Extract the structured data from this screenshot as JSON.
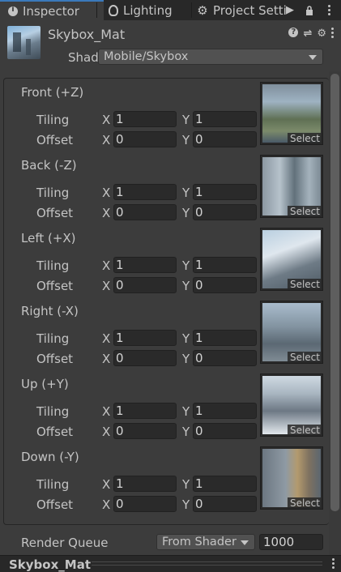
{
  "tabs": [
    {
      "label": "Inspector",
      "icon": "info-icon"
    },
    {
      "label": "Lighting",
      "icon": "bulb-icon"
    },
    {
      "label": "Project Setti",
      "icon": "gear-icon"
    }
  ],
  "material": {
    "name": "Skybox_Mat"
  },
  "shader": {
    "label": "Shader",
    "value": "Mobile/Skybox"
  },
  "faces": [
    {
      "title": "Front (+Z)",
      "tiling_label": "Tiling",
      "offset_label": "Offset",
      "tiling": {
        "x": "1",
        "y": "1"
      },
      "offset": {
        "x": "0",
        "y": "0"
      },
      "select": "Select"
    },
    {
      "title": "Back (-Z)",
      "tiling_label": "Tiling",
      "offset_label": "Offset",
      "tiling": {
        "x": "1",
        "y": "1"
      },
      "offset": {
        "x": "0",
        "y": "0"
      },
      "select": "Select"
    },
    {
      "title": "Left (+X)",
      "tiling_label": "Tiling",
      "offset_label": "Offset",
      "tiling": {
        "x": "1",
        "y": "1"
      },
      "offset": {
        "x": "0",
        "y": "0"
      },
      "select": "Select"
    },
    {
      "title": "Right (-X)",
      "tiling_label": "Tiling",
      "offset_label": "Offset",
      "tiling": {
        "x": "1",
        "y": "1"
      },
      "offset": {
        "x": "0",
        "y": "0"
      },
      "select": "Select"
    },
    {
      "title": "Up (+Y)",
      "tiling_label": "Tiling",
      "offset_label": "Offset",
      "tiling": {
        "x": "1",
        "y": "1"
      },
      "offset": {
        "x": "0",
        "y": "0"
      },
      "select": "Select"
    },
    {
      "title": "Down (-Y)",
      "tiling_label": "Tiling",
      "offset_label": "Offset",
      "tiling": {
        "x": "1",
        "y": "1"
      },
      "offset": {
        "x": "0",
        "y": "0"
      },
      "select": "Select"
    }
  ],
  "axis": {
    "x": "X",
    "y": "Y"
  },
  "render_queue": {
    "label": "Render Queue",
    "mode": "From Shader",
    "value": "1000"
  },
  "footer": {
    "title": "Skybox_Mat"
  },
  "colors": {
    "accent": "#3a79bb",
    "panel": "#3c3c3c",
    "field": "#2a2a2a"
  }
}
